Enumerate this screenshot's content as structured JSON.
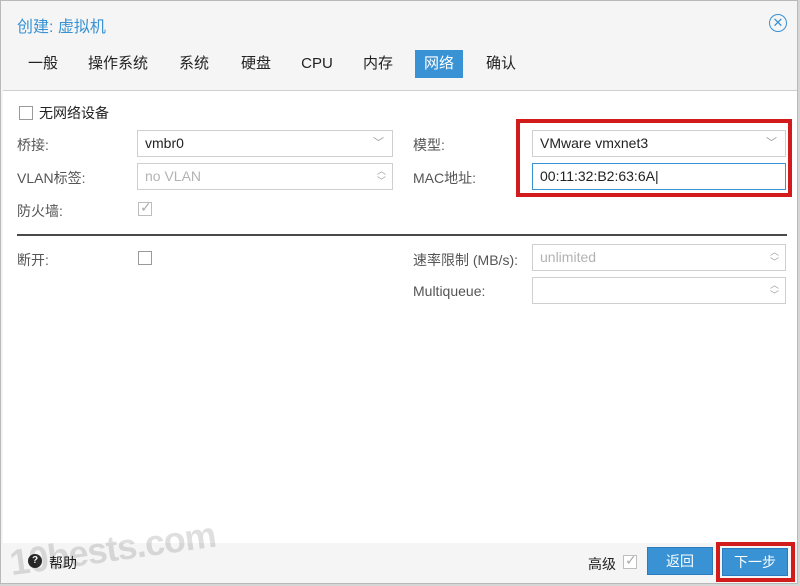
{
  "window": {
    "title": "创建: 虚拟机"
  },
  "tabs": [
    {
      "label": "一般"
    },
    {
      "label": "操作系统"
    },
    {
      "label": "系统"
    },
    {
      "label": "硬盘"
    },
    {
      "label": "CPU"
    },
    {
      "label": "内存"
    },
    {
      "label": "网络",
      "active": true
    },
    {
      "label": "确认"
    }
  ],
  "network": {
    "no_device_label": "无网络设备",
    "bridge_label": "桥接:",
    "bridge_value": "vmbr0",
    "vlan_label": "VLAN标签:",
    "vlan_placeholder": "no VLAN",
    "firewall_label": "防火墙:",
    "model_label": "模型:",
    "model_value": "VMware vmxnet3",
    "mac_label": "MAC地址:",
    "mac_value": "00:11:32:B2:63:6A",
    "disconnect_label": "断开:",
    "rate_label": "速率限制 (MB/s):",
    "rate_placeholder": "unlimited",
    "multiqueue_label": "Multiqueue:"
  },
  "footer": {
    "help_label": "帮助",
    "advanced_label": "高级",
    "back_label": "返回",
    "next_label": "下一步"
  },
  "watermark": "10bests.com",
  "colors": {
    "accent": "#3892d4",
    "highlight": "#d21c1c"
  }
}
